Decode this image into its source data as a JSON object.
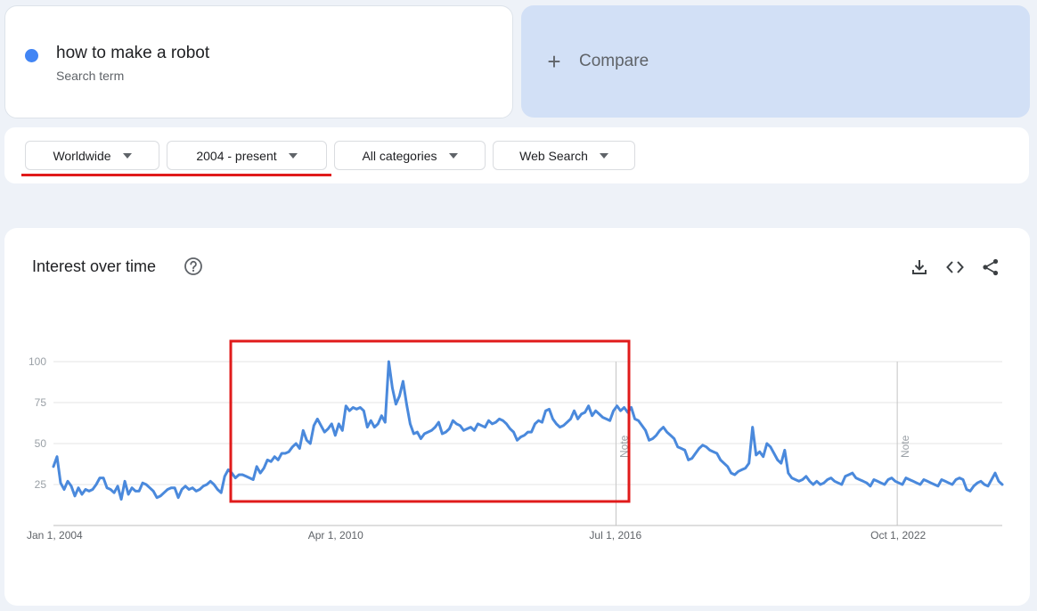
{
  "search_term": {
    "label": "how to make a robot",
    "sublabel": "Search term",
    "color": "#4285f4"
  },
  "compare": {
    "label": "Compare"
  },
  "filters": {
    "region": "Worldwide",
    "time_range": "2004 - present",
    "category": "All categories",
    "search_type": "Web Search"
  },
  "chart_card": {
    "title": "Interest over time",
    "icons": [
      "help-icon",
      "download-icon",
      "embed-icon",
      "share-icon"
    ]
  },
  "chart_data": {
    "type": "line",
    "ylim": [
      0,
      100
    ],
    "y_ticks": [
      "100",
      "75",
      "50",
      "25"
    ],
    "x_ticks": [
      {
        "label": "Jan 1, 2004",
        "date": "2004-01-01"
      },
      {
        "label": "Apr 1, 2010",
        "date": "2010-04-01"
      },
      {
        "label": "Jul 1, 2016",
        "date": "2016-07-01"
      },
      {
        "label": "Oct 1, 2022",
        "date": "2022-10-01"
      }
    ],
    "notes": [
      {
        "label": "Note",
        "date": "2016-07-01"
      },
      {
        "label": "Note",
        "date": "2022-10-01"
      }
    ],
    "start": "2004-01",
    "end": "2025-02",
    "line_color": "#4a89dc",
    "values": [
      36,
      42,
      26,
      22,
      27,
      24,
      18,
      23,
      19,
      22,
      21,
      22,
      25,
      29,
      29,
      23,
      22,
      20,
      24,
      16,
      27,
      19,
      23,
      21,
      21,
      26,
      25,
      23,
      21,
      17,
      18,
      20,
      22,
      23,
      23,
      17,
      22,
      24,
      22,
      23,
      21,
      22,
      24,
      25,
      27,
      25,
      22,
      20,
      30,
      34,
      32,
      29,
      31,
      31,
      30,
      29,
      28,
      36,
      32,
      35,
      40,
      39,
      42,
      40,
      44,
      44,
      45,
      48,
      50,
      47,
      58,
      52,
      50,
      61,
      65,
      61,
      57,
      59,
      62,
      55,
      62,
      58,
      73,
      70,
      72,
      71,
      72,
      70,
      60,
      64,
      60,
      62,
      67,
      63,
      100,
      84,
      74,
      79,
      88,
      74,
      62,
      56,
      57,
      53,
      56,
      57,
      58,
      60,
      63,
      56,
      57,
      59,
      64,
      62,
      61,
      58,
      59,
      60,
      58,
      62,
      61,
      60,
      64,
      62,
      63,
      65,
      64,
      62,
      59,
      57,
      52,
      54,
      55,
      57,
      57,
      62,
      64,
      63,
      70,
      71,
      65,
      62,
      60,
      61,
      63,
      65,
      70,
      65,
      68,
      69,
      73,
      67,
      70,
      68,
      66,
      65,
      64,
      70,
      73,
      70,
      72,
      69,
      72,
      65,
      64,
      61,
      58,
      52,
      53,
      55,
      58,
      60,
      57,
      55,
      53,
      48,
      47,
      46,
      40,
      41,
      44,
      47,
      49,
      48,
      46,
      45,
      44,
      40,
      38,
      36,
      32,
      31,
      33,
      34,
      35,
      38,
      60,
      43,
      45,
      42,
      50,
      48,
      44,
      40,
      38,
      46,
      32,
      29,
      28,
      27,
      28,
      30,
      27,
      25,
      27,
      25,
      26,
      28,
      29,
      27,
      26,
      25,
      30,
      31,
      32,
      29,
      28,
      27,
      26,
      24,
      28,
      27,
      26,
      25,
      28,
      29,
      27,
      26,
      25,
      29,
      28,
      27,
      26,
      25,
      28,
      27,
      26,
      25,
      24,
      28,
      27,
      26,
      25,
      28,
      29,
      28,
      22,
      21,
      24,
      26,
      27,
      25,
      24,
      28,
      32,
      27,
      25
    ]
  }
}
